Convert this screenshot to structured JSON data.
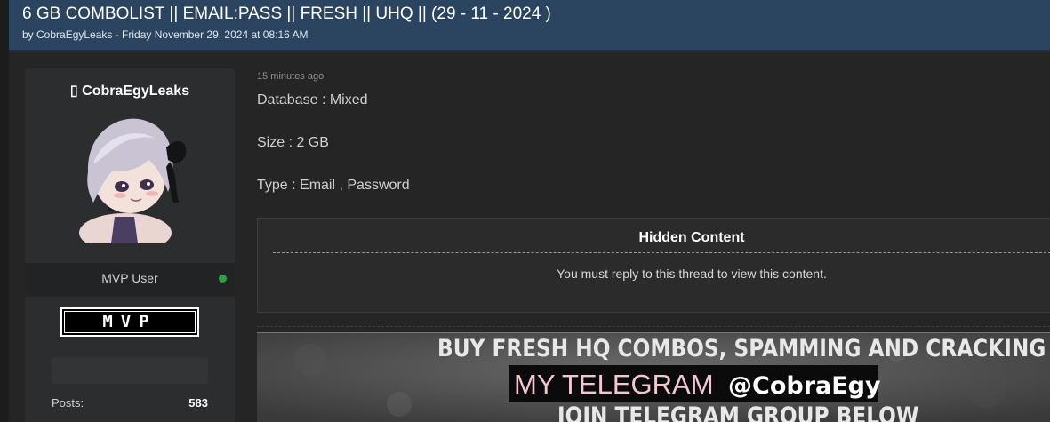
{
  "thread": {
    "title": "6 GB COMBOLIST || EMAIL:PASS || FRESH || UHQ || (29 - 11 - 2024 )",
    "meta": "by CobraEgyLeaks - Friday November 29, 2024 at 08:16 AM"
  },
  "user": {
    "name": "▯ CobraEgyLeaks",
    "title": "MVP User",
    "badge": "MVP",
    "stats": [
      {
        "label": "Posts:",
        "value": "583"
      }
    ]
  },
  "post": {
    "timestamp": "15 minutes ago",
    "lines": [
      "Database : Mixed",
      "Size : 2 GB",
      "Type : Email , Password"
    ],
    "hidden": {
      "title": "Hidden Content",
      "text": "You must reply to this thread to view this content."
    },
    "banner": {
      "line1": "BUY FRESH HQ COMBOS, SPAMMING AND CRACKING TOOLS",
      "telegram_prefix": "MY TELEGRAM",
      "telegram_handle": "@CobraEgy",
      "line3": "JOIN TELEGRAM GROUP BELOW"
    }
  },
  "colors": {
    "header_bg": "#2b4560",
    "page_bg": "#252525",
    "card_bg": "#2c2d2f",
    "online": "#2ea043"
  }
}
